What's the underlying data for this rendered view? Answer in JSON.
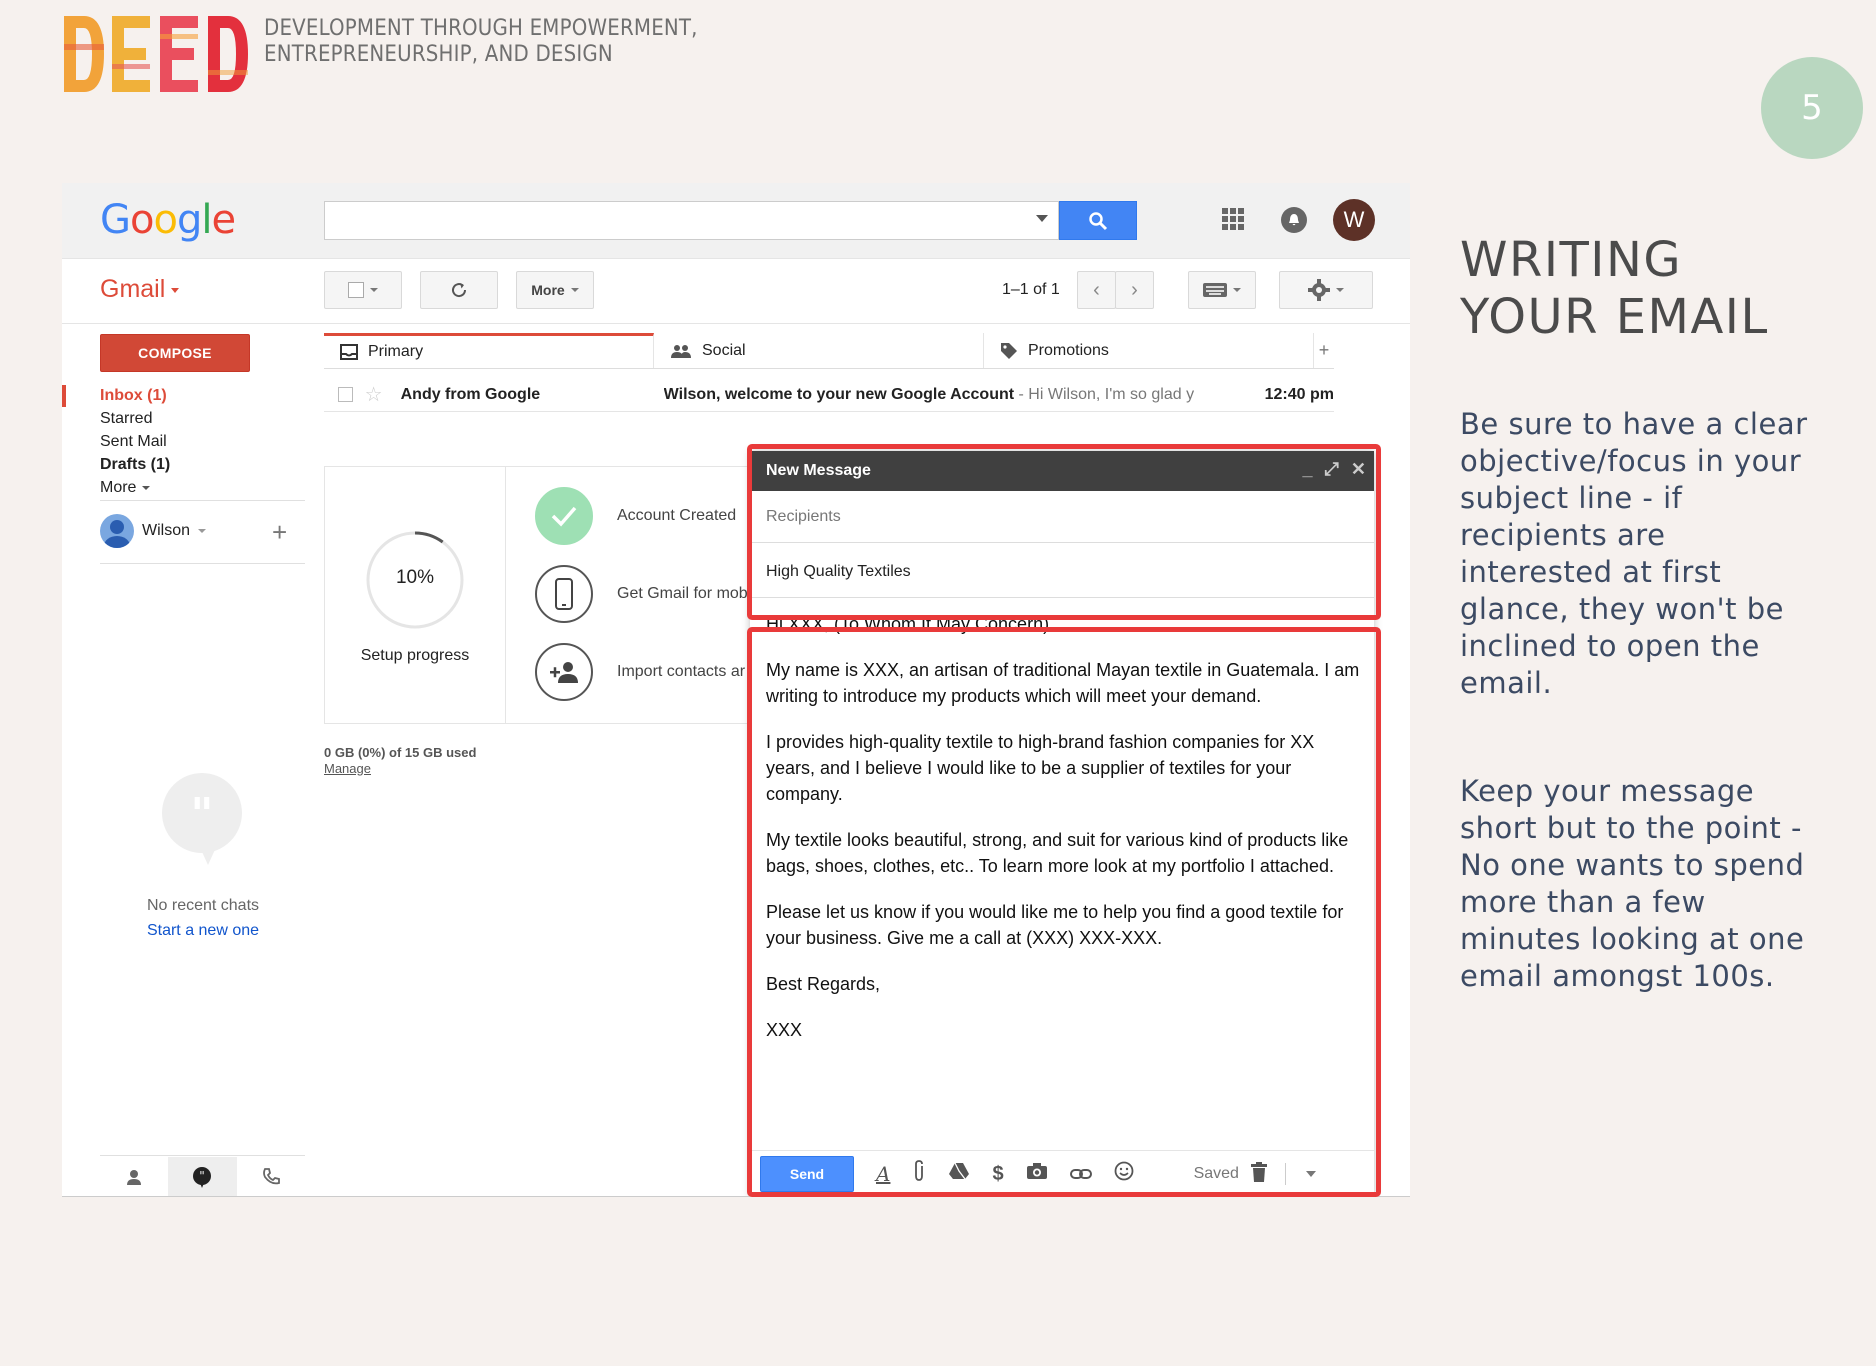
{
  "slide": {
    "logo_text": "DEED",
    "tagline_line1": "DEVELOPMENT THROUGH EMPOWERMENT,",
    "tagline_line2": "ENTREPRENEURSHIP, AND DESIGN",
    "page_number": "5",
    "title_line1": "WRITING",
    "title_line2": "YOUR EMAIL",
    "paragraph1": "Be sure to have a clear objective/focus in your subject line - if recipients are interested at first glance, they won't be inclined to open the email.",
    "paragraph2": "Keep your message short but to the point - No one wants to spend more than a few minutes looking at one email amongst 100s.",
    "colors": {
      "badge": "#b9d7c0",
      "highlight": "#e93a3a",
      "title": "#4b4b4b",
      "body_text": "#3c4a63"
    }
  },
  "gmail": {
    "google_logo": "Google",
    "app_label": "Gmail",
    "search": {
      "value": "",
      "button_icon": "search-icon"
    },
    "account_initial": "W",
    "toolbar": {
      "more_label": "More",
      "pager": "1–1 of 1"
    },
    "compose_label": "COMPOSE",
    "nav": {
      "inbox": "Inbox (1)",
      "starred": "Starred",
      "sent": "Sent Mail",
      "drafts": "Drafts (1)",
      "more": "More"
    },
    "user_name": "Wilson",
    "tabs": [
      {
        "label": "Primary",
        "icon": "inbox-icon"
      },
      {
        "label": "Social",
        "icon": "people-icon"
      },
      {
        "label": "Promotions",
        "icon": "tag-icon"
      }
    ],
    "inbox_row": {
      "from": "Andy from Google",
      "subject": "Wilson, welcome to your new Google Account",
      "snippet": " - Hi Wilson, I'm so glad y",
      "time": "12:40 pm"
    },
    "setup": {
      "progress": "10%",
      "progress_fraction": 0.1,
      "progress_label": "Setup progress",
      "items": [
        "Account Created",
        "Get Gmail for mob",
        "Import contacts ar"
      ]
    },
    "storage": {
      "used": "0 GB (0%) of 15 GB used",
      "manage": "Manage"
    },
    "chat": {
      "empty": "No recent chats",
      "start": "Start a new one"
    },
    "compose": {
      "title": "New Message",
      "recipients_placeholder": "Recipients",
      "subject": "High Quality Textiles",
      "body": [
        "Hi XXX, (To Whom It May Concern)",
        "My name is XXX, an artisan of traditional Mayan textile in Guatemala. I am writing to introduce my products which will meet your demand.",
        "I provides high-quality textile to high-brand fashion companies for XX years, and I believe I would like to be a supplier of textiles for your company.",
        "My textile looks beautiful, strong, and suit for various kind of products like bags, shoes, clothes, etc.. To learn more look at my portfolio I attached.",
        "Please let us know if you would like me to help you find a good textile for your business. Give me a call at (XXX) XXX-XXX.",
        "Best Regards,",
        "XXX"
      ],
      "send_label": "Send",
      "saved_label": "Saved"
    }
  }
}
